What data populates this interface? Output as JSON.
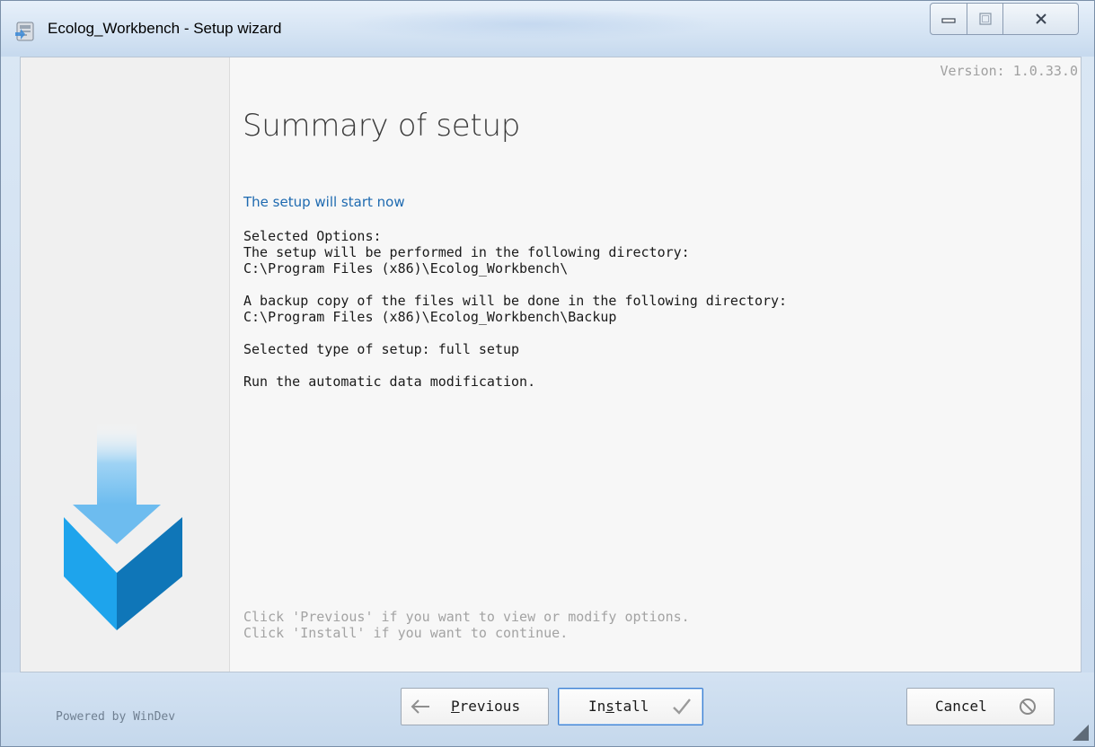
{
  "window": {
    "title": "Ecolog_Workbench - Setup wizard",
    "icon": "installer-icon",
    "controls": [
      "minimize-icon",
      "maximize-icon",
      "close-icon"
    ]
  },
  "header": {
    "version": "Version: 1.0.33.0",
    "title": "Summary of setup",
    "subtitle": "The setup will start now"
  },
  "summary": {
    "lines": [
      "Selected Options:",
      "The setup will be performed in the following directory:",
      "C:\\Program Files (x86)\\Ecolog_Workbench\\",
      "",
      "A backup copy of the files will be done in the following directory:",
      "C:\\Program Files (x86)\\Ecolog_Workbench\\Backup",
      "",
      "Selected type of setup: full setup",
      "",
      "Run the automatic data modification."
    ]
  },
  "hint": {
    "lines": [
      "Click 'Previous' if you want to view or modify options.",
      "Click 'Install' if you want to continue."
    ]
  },
  "footer": {
    "powered_by": "Powered by WinDev",
    "previous": {
      "pre": "",
      "accel": "P",
      "post": "revious"
    },
    "install": {
      "pre": "In",
      "accel": "s",
      "post": "tall"
    },
    "cancel": "Cancel"
  },
  "colors": {
    "accent": "#1e6ab0",
    "logo_light": "#29a3e8",
    "logo_dark": "#1673b5",
    "footer": "#c9dbee"
  }
}
